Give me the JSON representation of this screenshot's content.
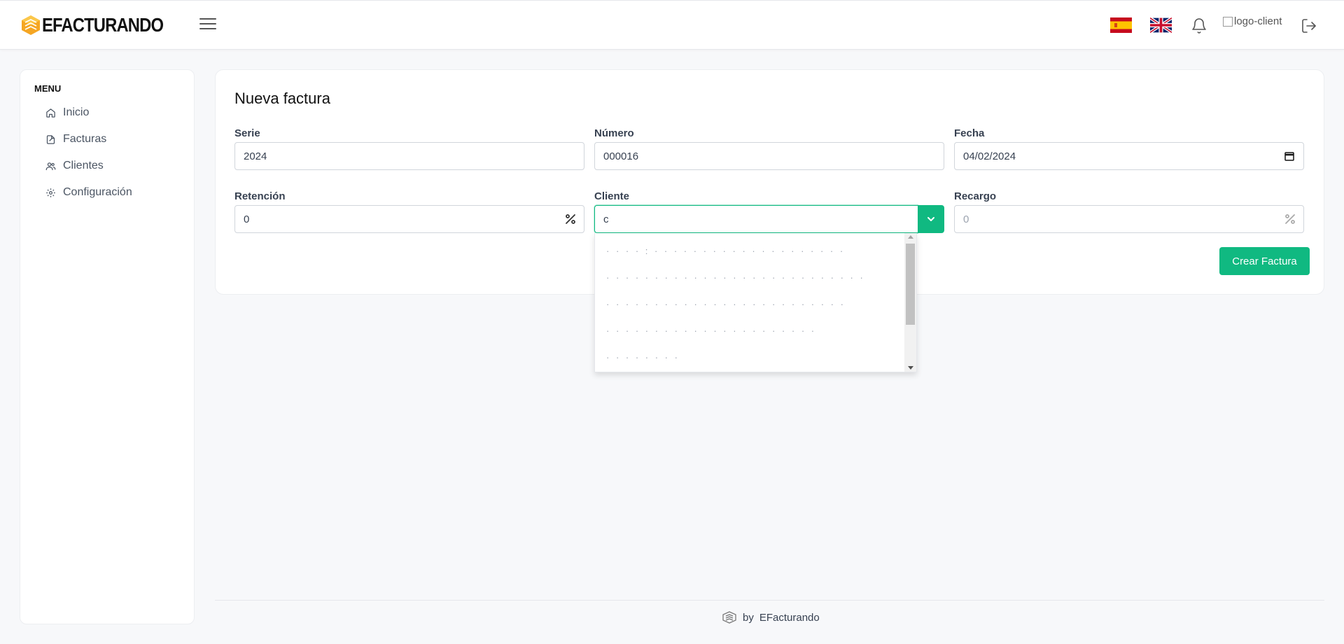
{
  "header": {
    "brand": "EFACTURANDO",
    "logo_client_alt": "logo-client",
    "icons": [
      "menu-icon",
      "flag-es-icon",
      "flag-uk-icon",
      "bell-icon",
      "logout-icon"
    ],
    "accent": "#10b981"
  },
  "sidebar": {
    "title": "MENU",
    "items": [
      {
        "label": "Inicio",
        "icon": "home-icon"
      },
      {
        "label": "Facturas",
        "icon": "invoice-icon"
      },
      {
        "label": "Clientes",
        "icon": "users-icon"
      },
      {
        "label": "Configuración",
        "icon": "gear-icon"
      }
    ]
  },
  "form": {
    "title": "Nueva factura",
    "serie": {
      "label": "Serie",
      "value": "2024"
    },
    "numero": {
      "label": "Número",
      "value": "000016"
    },
    "fecha": {
      "label": "Fecha",
      "value": "04/02/2024"
    },
    "retencion": {
      "label": "Retención",
      "value": "0"
    },
    "cliente": {
      "label": "Cliente",
      "value": "c"
    },
    "recargo": {
      "label": "Recargo",
      "value": "0"
    },
    "submit": "Crear Factura"
  },
  "dropdown": {
    "items": [
      "· · · · : · · · · · · · · · · · · · · · · · · · ·",
      "· · · · · · · · · · · · · · · · · · · · · · · · · · ·",
      "· · · · · · · · · · · · · · · · · · · · · · · · ·",
      "· · · · · · · · · · · · · · · · · · · · · ·",
      "· · · · · · · ·"
    ]
  },
  "footer": {
    "by": "by",
    "brand": "EFacturando"
  }
}
